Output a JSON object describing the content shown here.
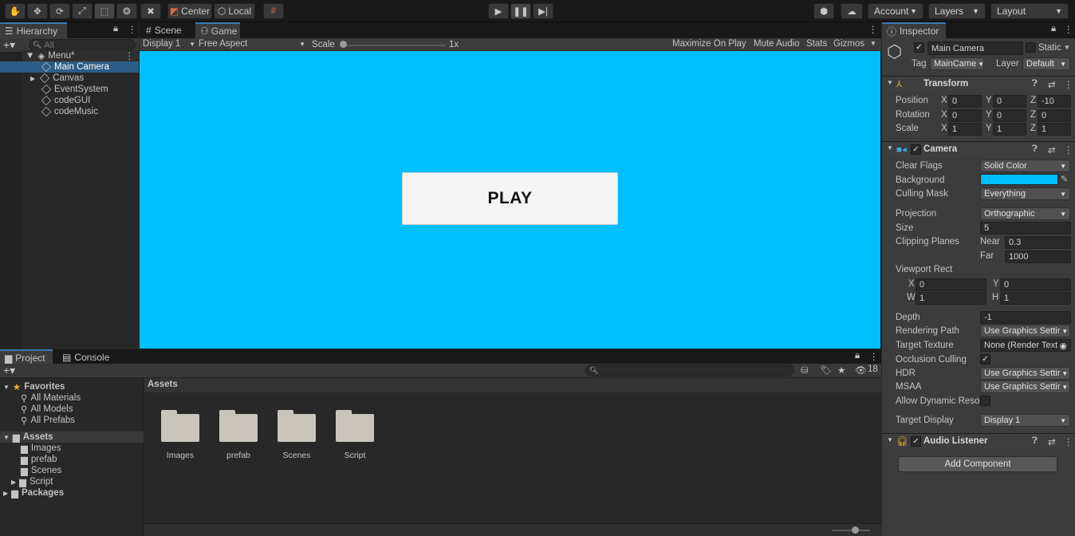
{
  "toolbar": {
    "pivot_label": "Center",
    "space_label": "Local",
    "account_label": "Account",
    "layers_label": "Layers",
    "layout_label": "Layout"
  },
  "hierarchy": {
    "tab_label": "Hierarchy",
    "search_placeholder": "All",
    "scene_name": "Menu*",
    "items": [
      "Main Camera",
      "Canvas",
      "EventSystem",
      "codeGUI",
      "codeMusic"
    ]
  },
  "game_view": {
    "tabs": [
      "Scene",
      "Game"
    ],
    "display_label": "Display 1",
    "aspect_label": "Free Aspect",
    "scale_label": "Scale",
    "scale_value": "1x",
    "toggles": [
      "Maximize On Play",
      "Mute Audio",
      "Stats",
      "Gizmos"
    ],
    "background_color": "#00bfff",
    "play_button_label": "PLAY"
  },
  "project": {
    "tabs": [
      "Project",
      "Console"
    ],
    "hidden_count": "18",
    "favorites_label": "Favorites",
    "favorites": [
      "All Materials",
      "All Models",
      "All Prefabs"
    ],
    "assets_label": "Assets",
    "asset_folders": [
      "Images",
      "prefab",
      "Scenes",
      "Script"
    ],
    "packages_label": "Packages",
    "breadcrumb": "Assets",
    "grid_folders": [
      "Images",
      "prefab",
      "Scenes",
      "Script"
    ]
  },
  "inspector": {
    "tab_label": "Inspector",
    "object_name": "Main Camera",
    "static_label": "Static",
    "tag_label": "Tag",
    "tag_value": "MainCame",
    "layer_label": "Layer",
    "layer_value": "Default",
    "transform": {
      "title": "Transform",
      "position_label": "Position",
      "rotation_label": "Rotation",
      "scale_label": "Scale",
      "position": [
        "0",
        "0",
        "-10"
      ],
      "rotation": [
        "0",
        "0",
        "0"
      ],
      "scale": [
        "1",
        "1",
        "1"
      ]
    },
    "camera": {
      "title": "Camera",
      "clear_flags_label": "Clear Flags",
      "clear_flags": "Solid Color",
      "background_label": "Background",
      "background_color": "#00bfff",
      "culling_mask_label": "Culling Mask",
      "culling_mask": "Everything",
      "projection_label": "Projection",
      "projection": "Orthographic",
      "size_label": "Size",
      "size": "5",
      "clipping_label": "Clipping Planes",
      "near_label": "Near",
      "near": "0.3",
      "far_label": "Far",
      "far": "1000",
      "viewport_label": "Viewport Rect",
      "vp_x": "0",
      "vp_y": "0",
      "vp_w": "1",
      "vp_h": "1",
      "depth_label": "Depth",
      "depth": "-1",
      "rendering_path_label": "Rendering Path",
      "rendering_path": "Use Graphics Settir",
      "target_texture_label": "Target Texture",
      "target_texture": "None (Render Text",
      "occlusion_label": "Occlusion Culling",
      "hdr_label": "HDR",
      "hdr": "Use Graphics Settir",
      "msaa_label": "MSAA",
      "msaa": "Use Graphics Settir",
      "dynamic_res_label": "Allow Dynamic Reso",
      "target_display_label": "Target Display",
      "target_display": "Display 1"
    },
    "audio_listener_title": "Audio Listener",
    "add_component_label": "Add Component"
  }
}
